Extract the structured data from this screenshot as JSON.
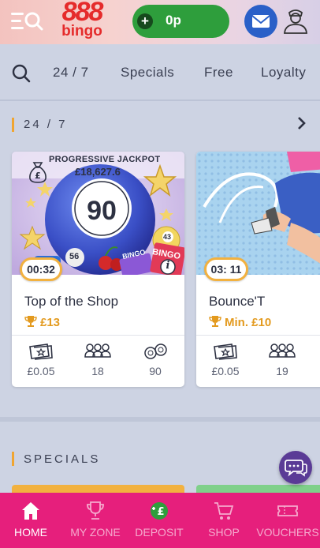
{
  "header": {
    "logo_number": "888",
    "logo_word": "bingo",
    "balance": "0p",
    "balance_plus": "+",
    "icons": [
      "menu-search-icon",
      "mail-icon",
      "user-icon"
    ]
  },
  "nav": {
    "items": [
      "24 / 7",
      "Specials",
      "Free",
      "Loyalty"
    ]
  },
  "sections": [
    {
      "title": "24 / 7",
      "bar_color": "#f0a531"
    },
    {
      "title": "SPECIALS",
      "bar_color": "#f0a531"
    }
  ],
  "games": [
    {
      "jackpot_label": "PROGRESSIVE JACKPOT",
      "jackpot_value": "£18,627.6",
      "ball_number": "90",
      "timer": "00:32",
      "title": "Top of the Shop",
      "prize": "£13",
      "ticket_price": "£0.05",
      "players": "18",
      "ball_type": "90",
      "ticket_labels": [
        "BINGO",
        "BINGO",
        "56",
        "43"
      ]
    },
    {
      "timer": "03: 11",
      "title": "Bounce'T",
      "prize": "Min. £10",
      "ticket_price": "£0.05",
      "players": "19"
    }
  ],
  "bottom_nav": [
    {
      "label": "HOME",
      "active": true
    },
    {
      "label": "MY ZONE",
      "active": false
    },
    {
      "label": "DEPOSIT",
      "active": false
    },
    {
      "label": "SHOP",
      "active": false
    },
    {
      "label": "VOUCHERS",
      "active": false
    }
  ],
  "deposit_icon_text": "£",
  "colors": {
    "brand_pink": "#e61f7c",
    "balance_green": "#2e9e3c",
    "accent_orange": "#f0a531",
    "logo_red": "#e52b2b",
    "chat_purple": "#5a3b96"
  }
}
